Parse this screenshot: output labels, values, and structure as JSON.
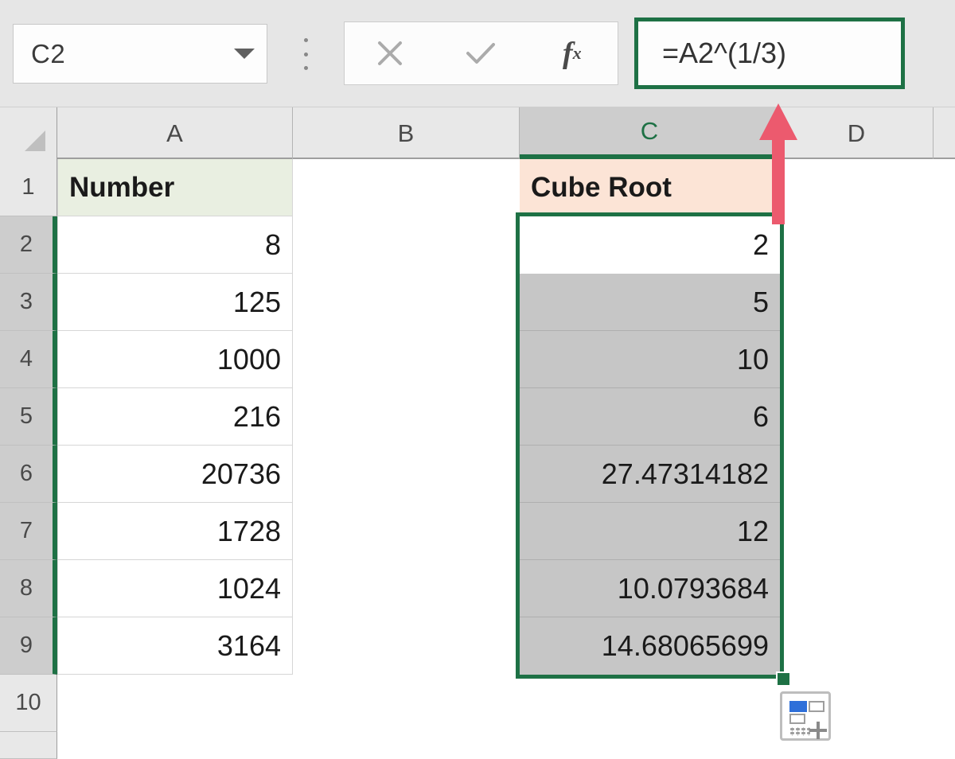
{
  "app": "Microsoft Excel",
  "formula_bar": {
    "name_box_value": "C2",
    "name_box_dropdown_icon": "chevron-down-icon",
    "more_options_icon": "kebab-menu-icon",
    "cancel_icon": "close-x-icon",
    "enter_icon": "checkmark-icon",
    "insert_function_icon": "fx-icon",
    "insert_function_label": "f",
    "insert_function_sub": "x",
    "formula_value": "=A2^(1/3)"
  },
  "grid": {
    "select_all_icon": "select-all-triangle-icon",
    "columns": [
      {
        "letter": "A",
        "selected": false
      },
      {
        "letter": "B",
        "selected": false
      },
      {
        "letter": "C",
        "selected": true
      },
      {
        "letter": "D",
        "selected": false
      }
    ],
    "rows": [
      {
        "number": "1",
        "selected": false
      },
      {
        "number": "2",
        "selected": true
      },
      {
        "number": "3",
        "selected": true
      },
      {
        "number": "4",
        "selected": true
      },
      {
        "number": "5",
        "selected": true
      },
      {
        "number": "6",
        "selected": true
      },
      {
        "number": "7",
        "selected": true
      },
      {
        "number": "8",
        "selected": true
      },
      {
        "number": "9",
        "selected": true
      },
      {
        "number": "10",
        "selected": false
      }
    ],
    "column_a": {
      "header": "Number",
      "header_fill": "#E9EFE1",
      "values": [
        "8",
        "125",
        "1000",
        "216",
        "20736",
        "1728",
        "1024",
        "3164"
      ]
    },
    "column_c": {
      "header": "Cube Root",
      "header_fill": "#FCE4D6",
      "values": [
        "2",
        "5",
        "10",
        "6",
        "27.47314182",
        "12",
        "10.0793684",
        "14.68065699"
      ]
    },
    "active_cell": "C2",
    "selection_range": "C2:C9",
    "fill_handle_name": "fill-handle",
    "autofill_button_icon": "autofill-options-icon"
  },
  "annotation": {
    "arrow_icon": "red-up-arrow-annotation",
    "arrow_color": "#EC5A6E"
  },
  "colors": {
    "excel_green": "#1E7145",
    "selected_cell_gray": "#C6C6C6",
    "header_gray": "#E8E8E8"
  }
}
